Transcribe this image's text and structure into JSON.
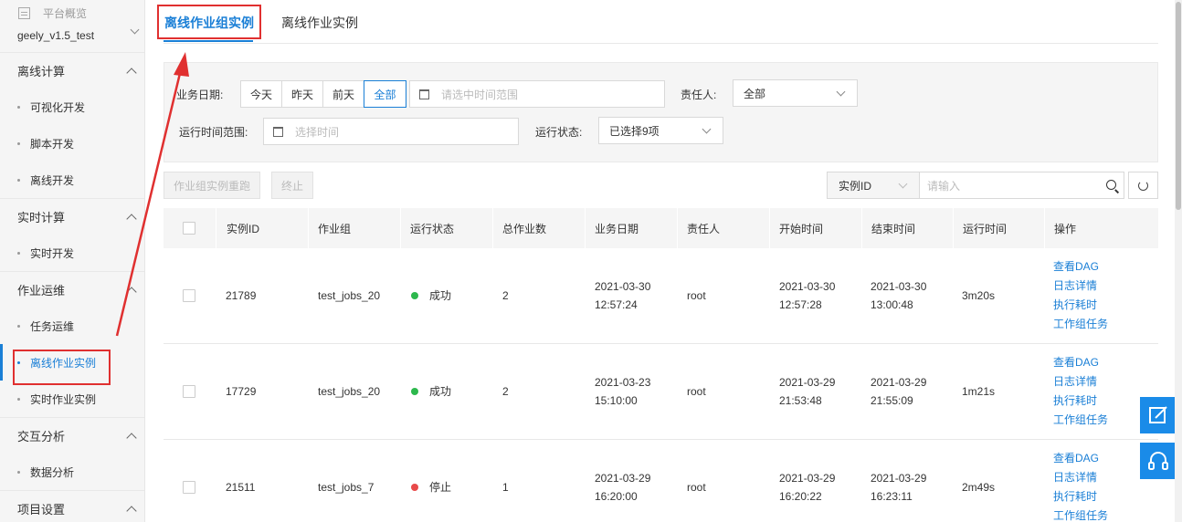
{
  "sidebar": {
    "overview": "平台概览",
    "project": "geely_v1.5_test",
    "groups": [
      {
        "label": "离线计算",
        "items": [
          "可视化开发",
          "脚本开发",
          "离线开发"
        ]
      },
      {
        "label": "实时计算",
        "items": [
          "实时开发"
        ]
      },
      {
        "label": "作业运维",
        "items": [
          "任务运维",
          "离线作业实例",
          "实时作业实例"
        ]
      },
      {
        "label": "交互分析",
        "items": [
          "数据分析"
        ]
      },
      {
        "label": "项目设置",
        "items": []
      }
    ],
    "active_item": "离线作业实例"
  },
  "tabs": [
    {
      "label": "离线作业组实例",
      "active": true
    },
    {
      "label": "离线作业实例",
      "active": false
    }
  ],
  "filter": {
    "business_date_label": "业务日期:",
    "date_buttons": [
      "今天",
      "昨天",
      "前天",
      "全部"
    ],
    "date_selected": "全部",
    "date_range_placeholder": "请选中时间范围",
    "owner_label": "责任人:",
    "owner_value": "全部",
    "run_time_label": "运行时间范围:",
    "run_time_placeholder": "选择时间",
    "run_status_label": "运行状态:",
    "run_status_value": "已选择9项"
  },
  "actions": {
    "rerun": "作业组实例重跑",
    "stop": "终止",
    "search_field": "实例ID",
    "search_placeholder": "请输入"
  },
  "table": {
    "columns": [
      "实例ID",
      "作业组",
      "运行状态",
      "总作业数",
      "业务日期",
      "责任人",
      "开始时间",
      "结束时间",
      "运行时间",
      "操作"
    ],
    "rows": [
      {
        "id": "21789",
        "group": "test_jobs_20",
        "status": "成功",
        "status_color": "#2db84d",
        "total": "2",
        "biz_date": "2021-03-30",
        "biz_time": "12:57:24",
        "owner": "root",
        "start_date": "2021-03-30",
        "start_time": "12:57:28",
        "end_date": "2021-03-30",
        "end_time": "13:00:48",
        "duration": "3m20s"
      },
      {
        "id": "17729",
        "group": "test_jobs_20",
        "status": "成功",
        "status_color": "#2db84d",
        "total": "2",
        "biz_date": "2021-03-23",
        "biz_time": "15:10:00",
        "owner": "root",
        "start_date": "2021-03-29",
        "start_time": "21:53:48",
        "end_date": "2021-03-29",
        "end_time": "21:55:09",
        "duration": "1m21s"
      },
      {
        "id": "21511",
        "group": "test_jobs_7",
        "status": "停止",
        "status_color": "#e84a4a",
        "total": "1",
        "biz_date": "2021-03-29",
        "biz_time": "16:20:00",
        "owner": "root",
        "start_date": "2021-03-29",
        "start_time": "16:20:22",
        "end_date": "2021-03-29",
        "end_time": "16:23:11",
        "duration": "2m49s"
      }
    ],
    "row_ops": [
      "查看DAG",
      "日志详情",
      "执行耗时",
      "工作组任务"
    ]
  },
  "colors": {
    "accent": "#1a7fd6",
    "annotation": "#e03030",
    "float": "#1a8be8"
  }
}
